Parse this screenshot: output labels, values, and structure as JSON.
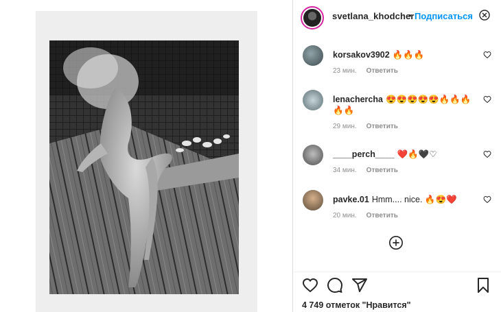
{
  "post": {
    "username": "svetlana_khodcher",
    "separator": "•",
    "follow_label": "Подписаться",
    "likes_text": "4 749 отметок \"Нравится\""
  },
  "comments": [
    {
      "user": "korsakov3902",
      "text": "🔥🔥🔥",
      "time": "23 мин.",
      "reply": "Ответить"
    },
    {
      "user": "lenachercha",
      "text": "😍😍😍😍😍🔥🔥🔥🔥🔥",
      "time": "29 мин.",
      "reply": "Ответить"
    },
    {
      "user": "____perch____",
      "text": "❤️🔥🖤♡",
      "time": "34 мин.",
      "reply": "Ответить"
    },
    {
      "user": "pavke.01",
      "text": "Hmm.... nice. 🔥😍❤️",
      "time": "20 мин.",
      "reply": "Ответить"
    }
  ],
  "icons": {
    "more": "more-options-icon",
    "comment_like": "heart-outline-icon",
    "load_more": "plus-circle-icon",
    "like": "heart-outline-icon",
    "comment": "speech-bubble-icon",
    "share": "paper-plane-icon",
    "save": "bookmark-icon"
  },
  "colors": {
    "accent": "#0095f6",
    "text": "#262626",
    "meta": "#8e8e8e"
  }
}
